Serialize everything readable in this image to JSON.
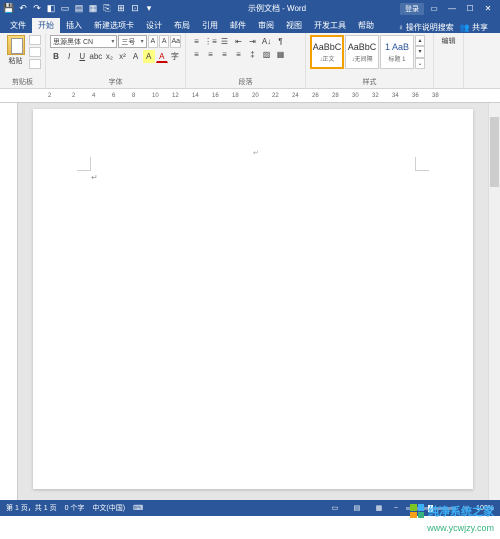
{
  "titlebar": {
    "doc_title": "示例文档 - Word",
    "login": "登录"
  },
  "tabs": {
    "file": "文件",
    "home": "开始",
    "insert": "插入",
    "newtab": "新建选项卡",
    "design": "设计",
    "layout": "布局",
    "references": "引用",
    "mailings": "邮件",
    "review": "审阅",
    "view": "视图",
    "developer": "开发工具",
    "help": "帮助",
    "tellme": "操作说明搜索",
    "share": "共享"
  },
  "ribbon": {
    "clipboard": {
      "label": "剪贴板",
      "paste": "粘贴"
    },
    "font": {
      "label": "字体",
      "name": "思源黑体 CN",
      "size": "三号",
      "bold": "B",
      "italic": "I",
      "underline": "U"
    },
    "paragraph": {
      "label": "段落"
    },
    "styles": {
      "label": "样式",
      "items": [
        {
          "sample": "AaBbC",
          "name": "↓正文"
        },
        {
          "sample": "AaBbC",
          "name": "↓无间隔"
        },
        {
          "sample": "1 AaB",
          "name": "标题 1"
        }
      ]
    },
    "editing": {
      "label": "编辑"
    }
  },
  "ruler": {
    "marks": [
      "2",
      "",
      "2",
      "4",
      "6",
      "8",
      "10",
      "12",
      "14",
      "16",
      "18",
      "20",
      "22",
      "24",
      "26",
      "28",
      "30",
      "32",
      "34",
      "36",
      "38"
    ]
  },
  "statusbar": {
    "page": "第 1 页，共 1 页",
    "words": "0 个字",
    "lang": "中文(中国)",
    "zoom": "100%"
  },
  "watermark": {
    "line1": "纯净系统之家",
    "line2": "www.ycwjzy.com"
  }
}
